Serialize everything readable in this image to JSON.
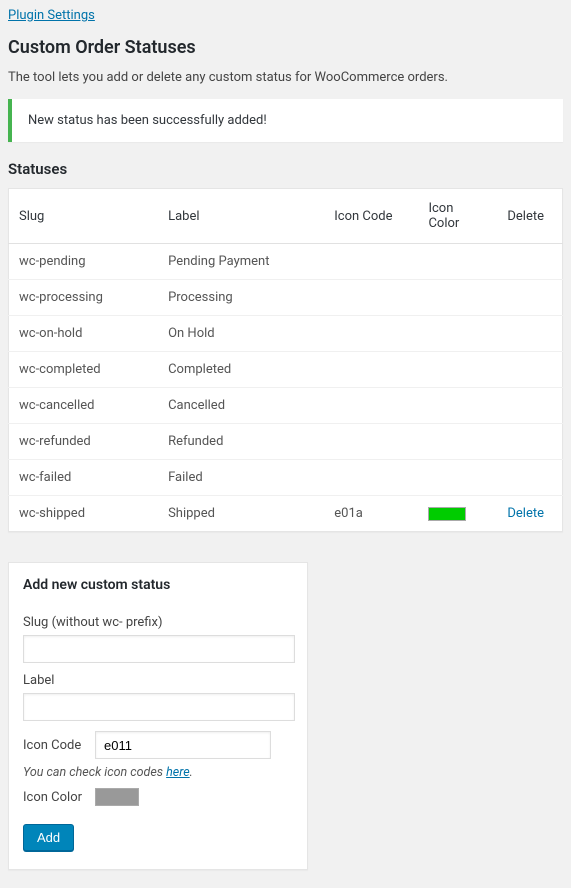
{
  "plugin_settings_link": "Plugin Settings",
  "page_title": "Custom Order Statuses",
  "description": "The tool lets you add or delete any custom status for WooCommerce orders.",
  "notice": "New status has been successfully added!",
  "statuses_heading": "Statuses",
  "table": {
    "headers": {
      "slug": "Slug",
      "label": "Label",
      "icon_code": "Icon Code",
      "icon_color": "Icon Color",
      "delete": "Delete"
    },
    "rows": [
      {
        "slug": "wc-pending",
        "label": "Pending Payment",
        "icon_code": "",
        "icon_color": "",
        "deletable": false
      },
      {
        "slug": "wc-processing",
        "label": "Processing",
        "icon_code": "",
        "icon_color": "",
        "deletable": false
      },
      {
        "slug": "wc-on-hold",
        "label": "On Hold",
        "icon_code": "",
        "icon_color": "",
        "deletable": false
      },
      {
        "slug": "wc-completed",
        "label": "Completed",
        "icon_code": "",
        "icon_color": "",
        "deletable": false
      },
      {
        "slug": "wc-cancelled",
        "label": "Cancelled",
        "icon_code": "",
        "icon_color": "",
        "deletable": false
      },
      {
        "slug": "wc-refunded",
        "label": "Refunded",
        "icon_code": "",
        "icon_color": "",
        "deletable": false
      },
      {
        "slug": "wc-failed",
        "label": "Failed",
        "icon_code": "",
        "icon_color": "",
        "deletable": false
      },
      {
        "slug": "wc-shipped",
        "label": "Shipped",
        "icon_code": "e01a",
        "icon_color": "#00cc00",
        "deletable": true
      }
    ],
    "delete_label": "Delete"
  },
  "form": {
    "title": "Add new custom status",
    "slug_label": "Slug (without wc- prefix)",
    "slug_value": "",
    "label_label": "Label",
    "label_value": "",
    "icon_code_label": "Icon Code",
    "icon_code_value": "e011",
    "hint_prefix": "You can check icon codes ",
    "hint_link": "here",
    "hint_suffix": ".",
    "icon_color_label": "Icon Color",
    "icon_color_value": "#999999",
    "add_button": "Add"
  }
}
